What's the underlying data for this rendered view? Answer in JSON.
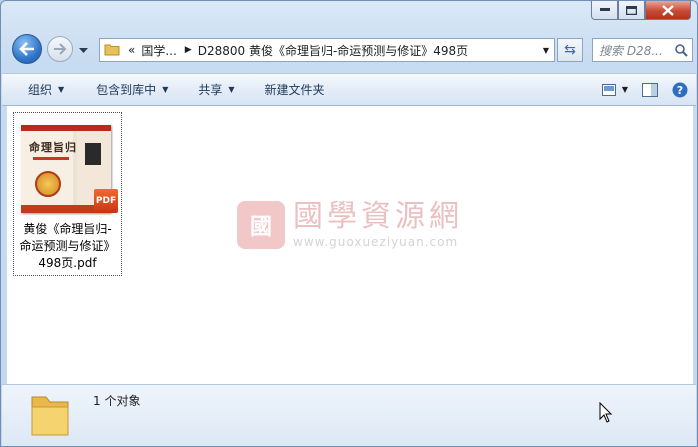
{
  "window": {
    "controls": {
      "minimize": "minimize",
      "maximize": "maximize",
      "close": "close"
    }
  },
  "nav": {
    "address": {
      "overflow": "«",
      "segments": [
        "国学...",
        "D28800 黄俊《命理旨归-命运预测与修证》498页"
      ]
    },
    "search_placeholder": "搜索 D28..."
  },
  "toolbar": {
    "organize": "组织",
    "include_in_library": "包含到库中",
    "share": "共享",
    "new_folder": "新建文件夹"
  },
  "file": {
    "name": "黄俊《命理旨归-命运预测与修证》498页.pdf",
    "name_lines": [
      "黄俊《命理旨归-",
      "命运预测与修证》",
      "498页.pdf"
    ],
    "badge": "PDF",
    "thumb_title": "命理旨归"
  },
  "watermark": {
    "seal": "國",
    "chinese": "國學資源網",
    "url": "www.guoxueziyuan.com"
  },
  "status": {
    "count_text": "1 个对象"
  },
  "colors": {
    "accent": "#2e76c9",
    "close": "#c74a35",
    "watermark": "#d98e8e"
  }
}
